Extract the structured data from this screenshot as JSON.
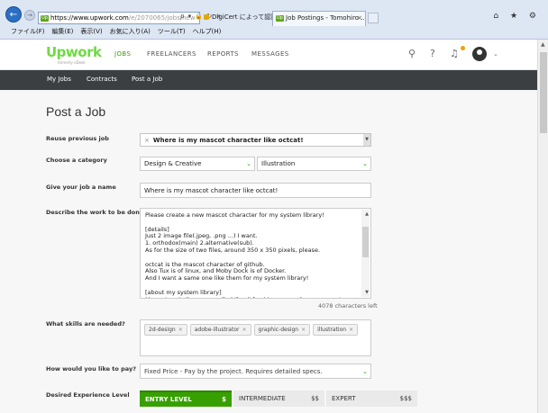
{
  "browser": {
    "address_domain": "https://www.upwork.com",
    "address_path": "/e/2070065/jobs/new",
    "address_icons": "ρ ▾ 🔒 ↻ ×",
    "cert_text": "DigiCert によって認証",
    "tab_title": "Job Postings - Tomohiro ...",
    "tab_close": "×",
    "favicon": "Up",
    "window_icons": "⌂ ★ ⚙",
    "menu": [
      "ファイル(F)",
      "編集(E)",
      "表示(V)",
      "お気に入り(A)",
      "ツール(T)",
      "ヘルプ(H)"
    ]
  },
  "header": {
    "logo": "Upwork",
    "logo_sub": "formerly oDesk",
    "nav": [
      "JOBS",
      "FREELANCERS",
      "REPORTS",
      "MESSAGES"
    ],
    "active_nav": "JOBS",
    "search_icon": "search-icon",
    "help_icon": "help-icon",
    "bell_icon": "bell-icon",
    "accent_color": "#37a000"
  },
  "subnav": {
    "items": [
      "My Jobs",
      "Contracts",
      "Post a Job"
    ]
  },
  "form": {
    "page_title": "Post a Job",
    "reuse_label": "Reuse previous job",
    "reuse_value": "Where is my mascot character like octcat!",
    "category_label": "Choose a category",
    "category_value": "Design & Creative",
    "subcategory_value": "Illustration",
    "name_label": "Give your job a name",
    "name_value": "Where is my mascot character like octcat!",
    "describe_label": "Describe the work to be done",
    "description": "Please create a new mascot character for my system library!\n\n[details]\nJust 2 image file(.jpeg, .png ...) I want.\n1. orthodox(main) 2.alternative(sub).\nAs for the size of two files, around 350 x 350 pixels, please.\n\noctcat is the mascot character of github.\nAlso Tux is of linux, and Moby Dock is of Docker.\nAnd I want a same one like them for my system library!\n\n[about my system library]\nMy system is the name called 'fumi'.fumi is a general-purpose system",
    "chars_left": "4078 characters left",
    "skills_label": "What skills are needed?",
    "skills": [
      "2d-design",
      "adobe-illustrator",
      "graphic-design",
      "illustration"
    ],
    "pay_label": "How would you like to pay?",
    "pay_value": "Fixed Price - Pay by the project. Requires detailed specs.",
    "experience_label": "Desired Experience Level",
    "levels": [
      {
        "name": "ENTRY LEVEL",
        "price": "$",
        "selected": true
      },
      {
        "name": "INTERMEDIATE",
        "price": "$$",
        "selected": false
      },
      {
        "name": "EXPERT",
        "price": "$$$",
        "selected": false
      }
    ]
  }
}
